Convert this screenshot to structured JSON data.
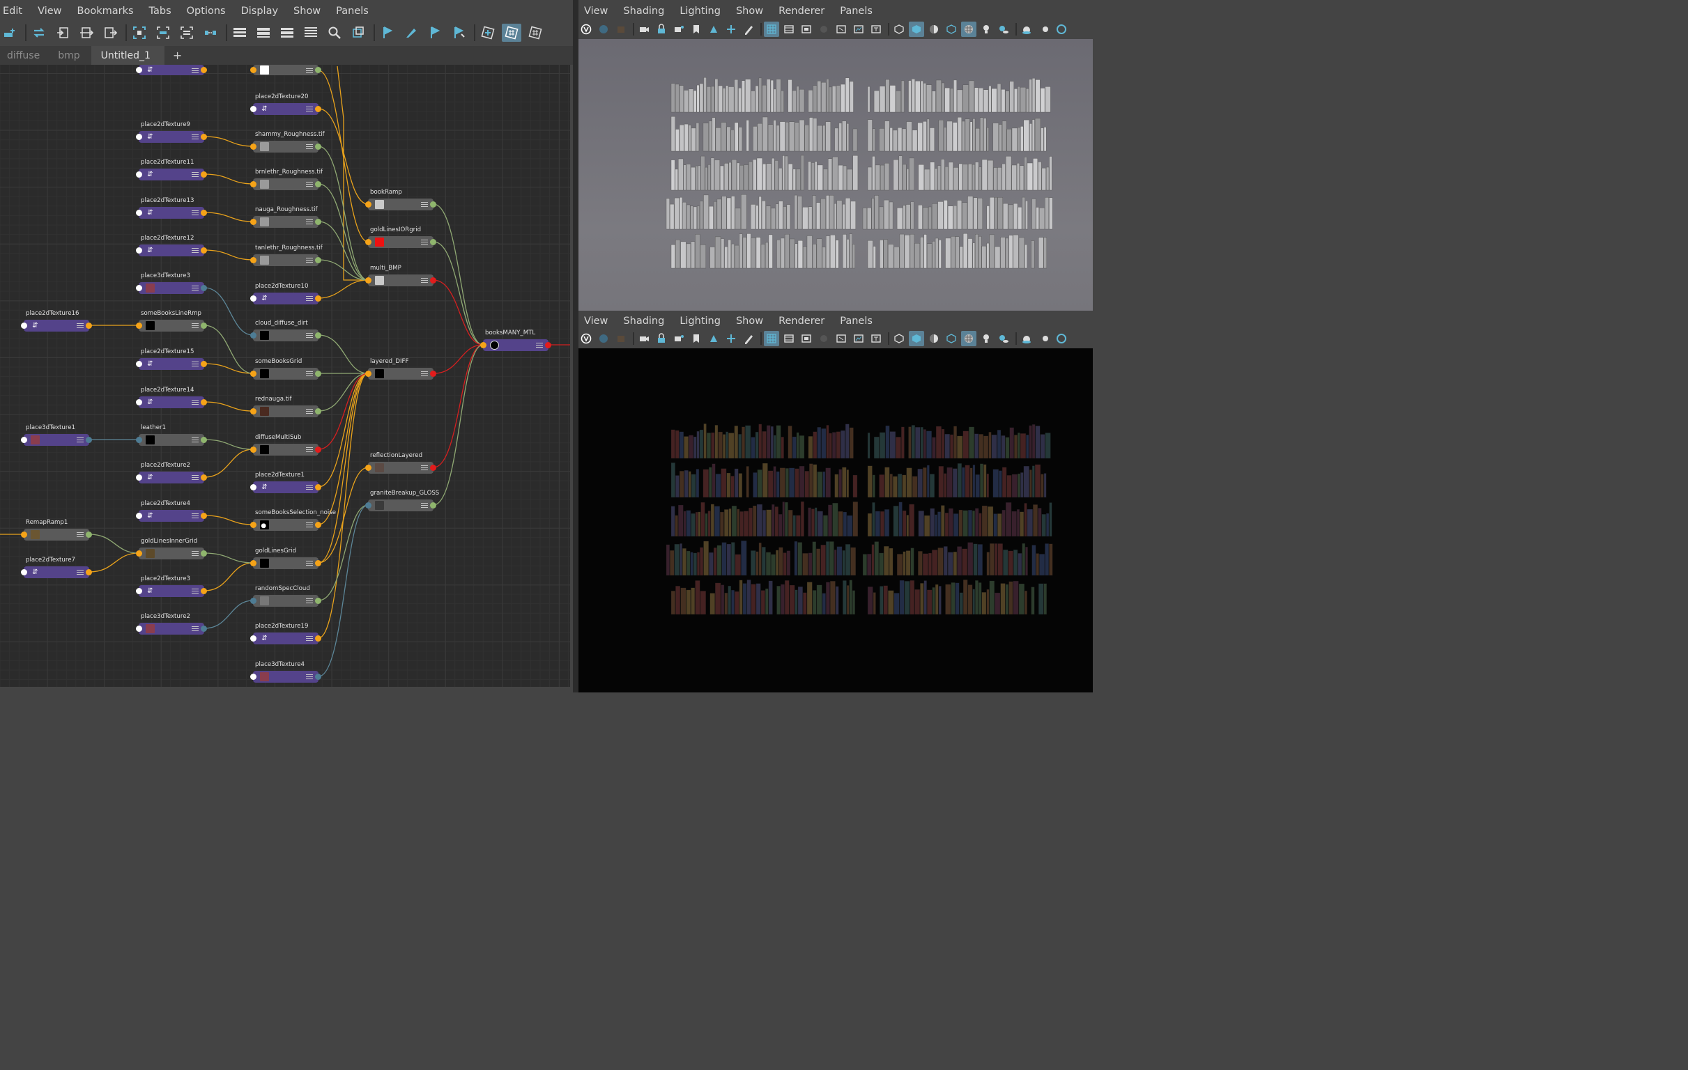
{
  "node_editor": {
    "menu": [
      "Edit",
      "View",
      "Bookmarks",
      "Tabs",
      "Options",
      "Display",
      "Show",
      "Panels"
    ],
    "tabs": [
      {
        "label": "diffuse",
        "active": false
      },
      {
        "label": "bmp",
        "active": false
      },
      {
        "label": "Untitled_1",
        "active": true
      },
      {
        "label": "+",
        "active": false
      }
    ],
    "toolbar_icons": [
      "graph-add-icon",
      "swap-icon",
      "input-connections-icon",
      "in-out-connections-icon",
      "output-connections-icon",
      "frame-all-icon",
      "frame-selected-icon",
      "select-downstream-icon",
      "select-upstream-icon",
      "layout-compact-icon",
      "layout-simple-icon",
      "layout-connected-icon",
      "layout-full-icon",
      "search-icon",
      "pin-icon",
      "bookmark-icon",
      "bookmark-edit-icon",
      "bookmark-prev-icon",
      "bookmark-next-icon",
      "attribute-view-icon",
      "grid-snap-icon",
      "grid-icon"
    ],
    "nodes": {
      "top_place": "",
      "top_white": "",
      "place2dTexture20": "place2dTexture20",
      "place2dTexture9": "place2dTexture9",
      "shammy_Roughness": "shammy_Roughness.tif",
      "place2dTexture11": "place2dTexture11",
      "brnlethr_Roughness": "brnlethr_Roughness.tif",
      "bookRamp": "bookRamp",
      "place2dTexture13": "place2dTexture13",
      "nauga_Roughness": "nauga_Roughness.tif",
      "goldLinesIORgrid": "goldLinesIORgrid",
      "place2dTexture12": "place2dTexture12",
      "tanlethr_Roughness": "tanlethr_Roughness.tif",
      "multi_BMP": "multi_BMP",
      "place3dTexture3": "place3dTexture3",
      "place2dTexture10": "place2dTexture10",
      "place2dTexture16": "place2dTexture16",
      "someBooksLineRmp": "someBooksLineRmp",
      "cloud_diffuse_dirt": "cloud_diffuse_dirt",
      "booksMANY_MTL": "booksMANY_MTL",
      "place2dTexture15": "place2dTexture15",
      "someBooksGrid": "someBooksGrid",
      "layered_DIFF": "layered_DIFF",
      "place2dTexture14": "place2dTexture14",
      "rednauga": "rednauga.tif",
      "place3dTexture1": "place3dTexture1",
      "leather1": "leather1",
      "diffuseMultiSub": "diffuseMultiSub",
      "place2dTexture2": "place2dTexture2",
      "reflectionLayered": "reflectionLayered",
      "place2dTexture1": "place2dTexture1",
      "graniteBreakup_GLOSS": "graniteBreakup_GLOSS",
      "place2dTexture4": "place2dTexture4",
      "someBooksSelection_noise": "someBooksSelection_noise",
      "RemapRamp1": "RemapRamp1",
      "goldLinesInnerGrid": "goldLinesInnerGrid",
      "goldLinesGrid": "goldLinesGrid",
      "place2dTexture7": "place2dTexture7",
      "place2dTexture3": "place2dTexture3",
      "randomSpecCloud": "randomSpecCloud",
      "place3dTexture2": "place3dTexture2",
      "place2dTexture19": "place2dTexture19",
      "place3dTexture4": "place3dTexture4"
    }
  },
  "viewport_top": {
    "menu": [
      "View",
      "Shading",
      "Lighting",
      "Show",
      "Renderer",
      "Panels"
    ]
  },
  "viewport_bottom": {
    "menu": [
      "View",
      "Shading",
      "Lighting",
      "Show",
      "Renderer",
      "Panels"
    ]
  },
  "colors": {
    "place_node": "#54438a",
    "texture_node": "#5a5a5a",
    "wire_orange": "#e8a21c",
    "wire_green": "#8fa873",
    "wire_red": "#d42020",
    "wire_blue": "#5c8698",
    "accent": "#5b8297"
  }
}
